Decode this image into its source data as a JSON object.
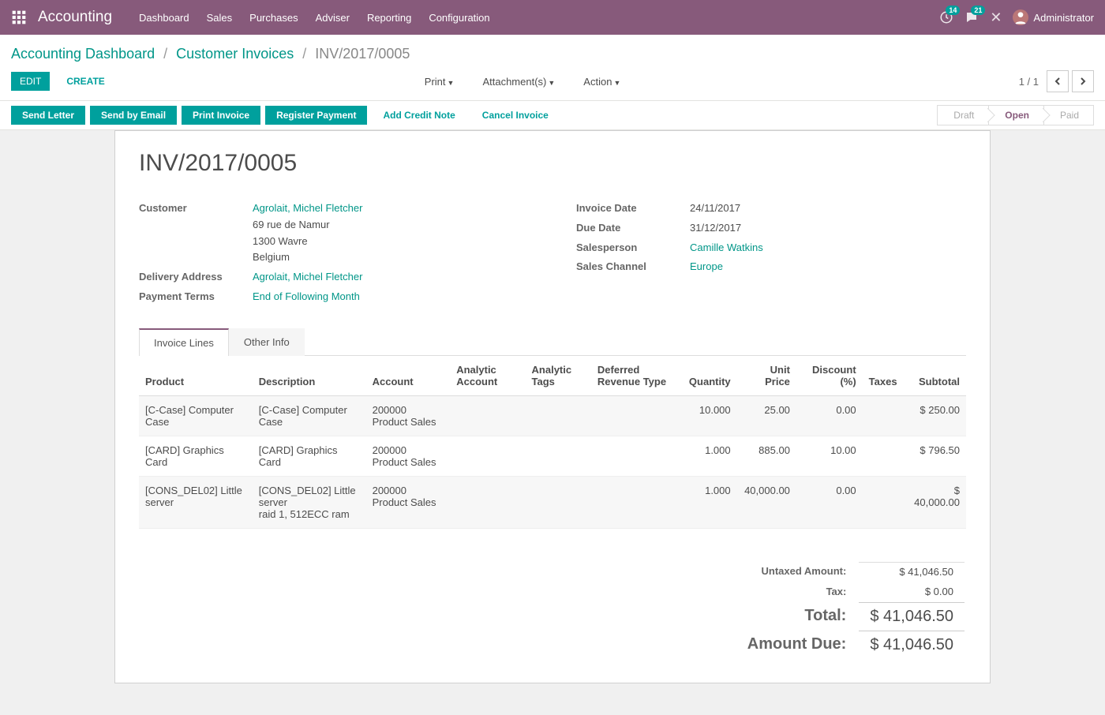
{
  "navbar": {
    "brand": "Accounting",
    "menu": [
      "Dashboard",
      "Sales",
      "Purchases",
      "Adviser",
      "Reporting",
      "Configuration"
    ],
    "user": "Administrator",
    "badge1": "14",
    "badge2": "21"
  },
  "breadcrumbs": {
    "items": [
      "Accounting Dashboard",
      "Customer Invoices"
    ],
    "current": "INV/2017/0005"
  },
  "toolbar": {
    "edit": "Edit",
    "create": "Create",
    "print": "Print",
    "attachments": "Attachment(s)",
    "action": "Action",
    "pager": "1 / 1"
  },
  "statusbar": {
    "buttons": [
      "Send Letter",
      "Send by Email",
      "Print Invoice",
      "Register Payment"
    ],
    "link_buttons": [
      "Add Credit Note",
      "Cancel Invoice"
    ],
    "states": [
      "Draft",
      "Open",
      "Paid"
    ],
    "active_state": "Open"
  },
  "invoice": {
    "title": "INV/2017/0005",
    "customer_link": "Agrolait, Michel Fletcher",
    "address": [
      "69 rue de Namur",
      "1300 Wavre",
      "Belgium"
    ],
    "delivery_address": "Agrolait, Michel Fletcher",
    "payment_terms": "End of Following Month",
    "invoice_date": "24/11/2017",
    "due_date": "31/12/2017",
    "salesperson": "Camille Watkins",
    "sales_channel": "Europe",
    "labels": {
      "customer": "Customer",
      "delivery": "Delivery Address",
      "payment_terms": "Payment Terms",
      "invoice_date": "Invoice Date",
      "due_date": "Due Date",
      "salesperson": "Salesperson",
      "sales_channel": "Sales Channel"
    }
  },
  "tabs": {
    "invoice_lines": "Invoice Lines",
    "other_info": "Other Info"
  },
  "table": {
    "headers": {
      "product": "Product",
      "description": "Description",
      "account": "Account",
      "analytic_account": "Analytic Account",
      "analytic_tags": "Analytic Tags",
      "deferred": "Deferred Revenue Type",
      "quantity": "Quantity",
      "unit_price": "Unit Price",
      "discount": "Discount (%)",
      "taxes": "Taxes",
      "subtotal": "Subtotal"
    },
    "rows": [
      {
        "product": "[C-Case] Computer Case",
        "description": "[C-Case] Computer Case",
        "account": "200000 Product Sales",
        "quantity": "10.000",
        "unit_price": "25.00",
        "discount": "0.00",
        "subtotal": "$ 250.00"
      },
      {
        "product": "[CARD] Graphics Card",
        "description": "[CARD] Graphics Card",
        "account": "200000 Product Sales",
        "quantity": "1.000",
        "unit_price": "885.00",
        "discount": "10.00",
        "subtotal": "$ 796.50"
      },
      {
        "product": "[CONS_DEL02] Little server",
        "description": "[CONS_DEL02] Little server\nraid 1, 512ECC ram",
        "account": "200000 Product Sales",
        "quantity": "1.000",
        "unit_price": "40,000.00",
        "discount": "0.00",
        "subtotal": "$ 40,000.00"
      }
    ]
  },
  "totals": {
    "untaxed_label": "Untaxed Amount:",
    "untaxed": "$ 41,046.50",
    "tax_label": "Tax:",
    "tax": "$ 0.00",
    "total_label": "Total:",
    "total": "$ 41,046.50",
    "due_label": "Amount Due:",
    "due": "$ 41,046.50"
  }
}
